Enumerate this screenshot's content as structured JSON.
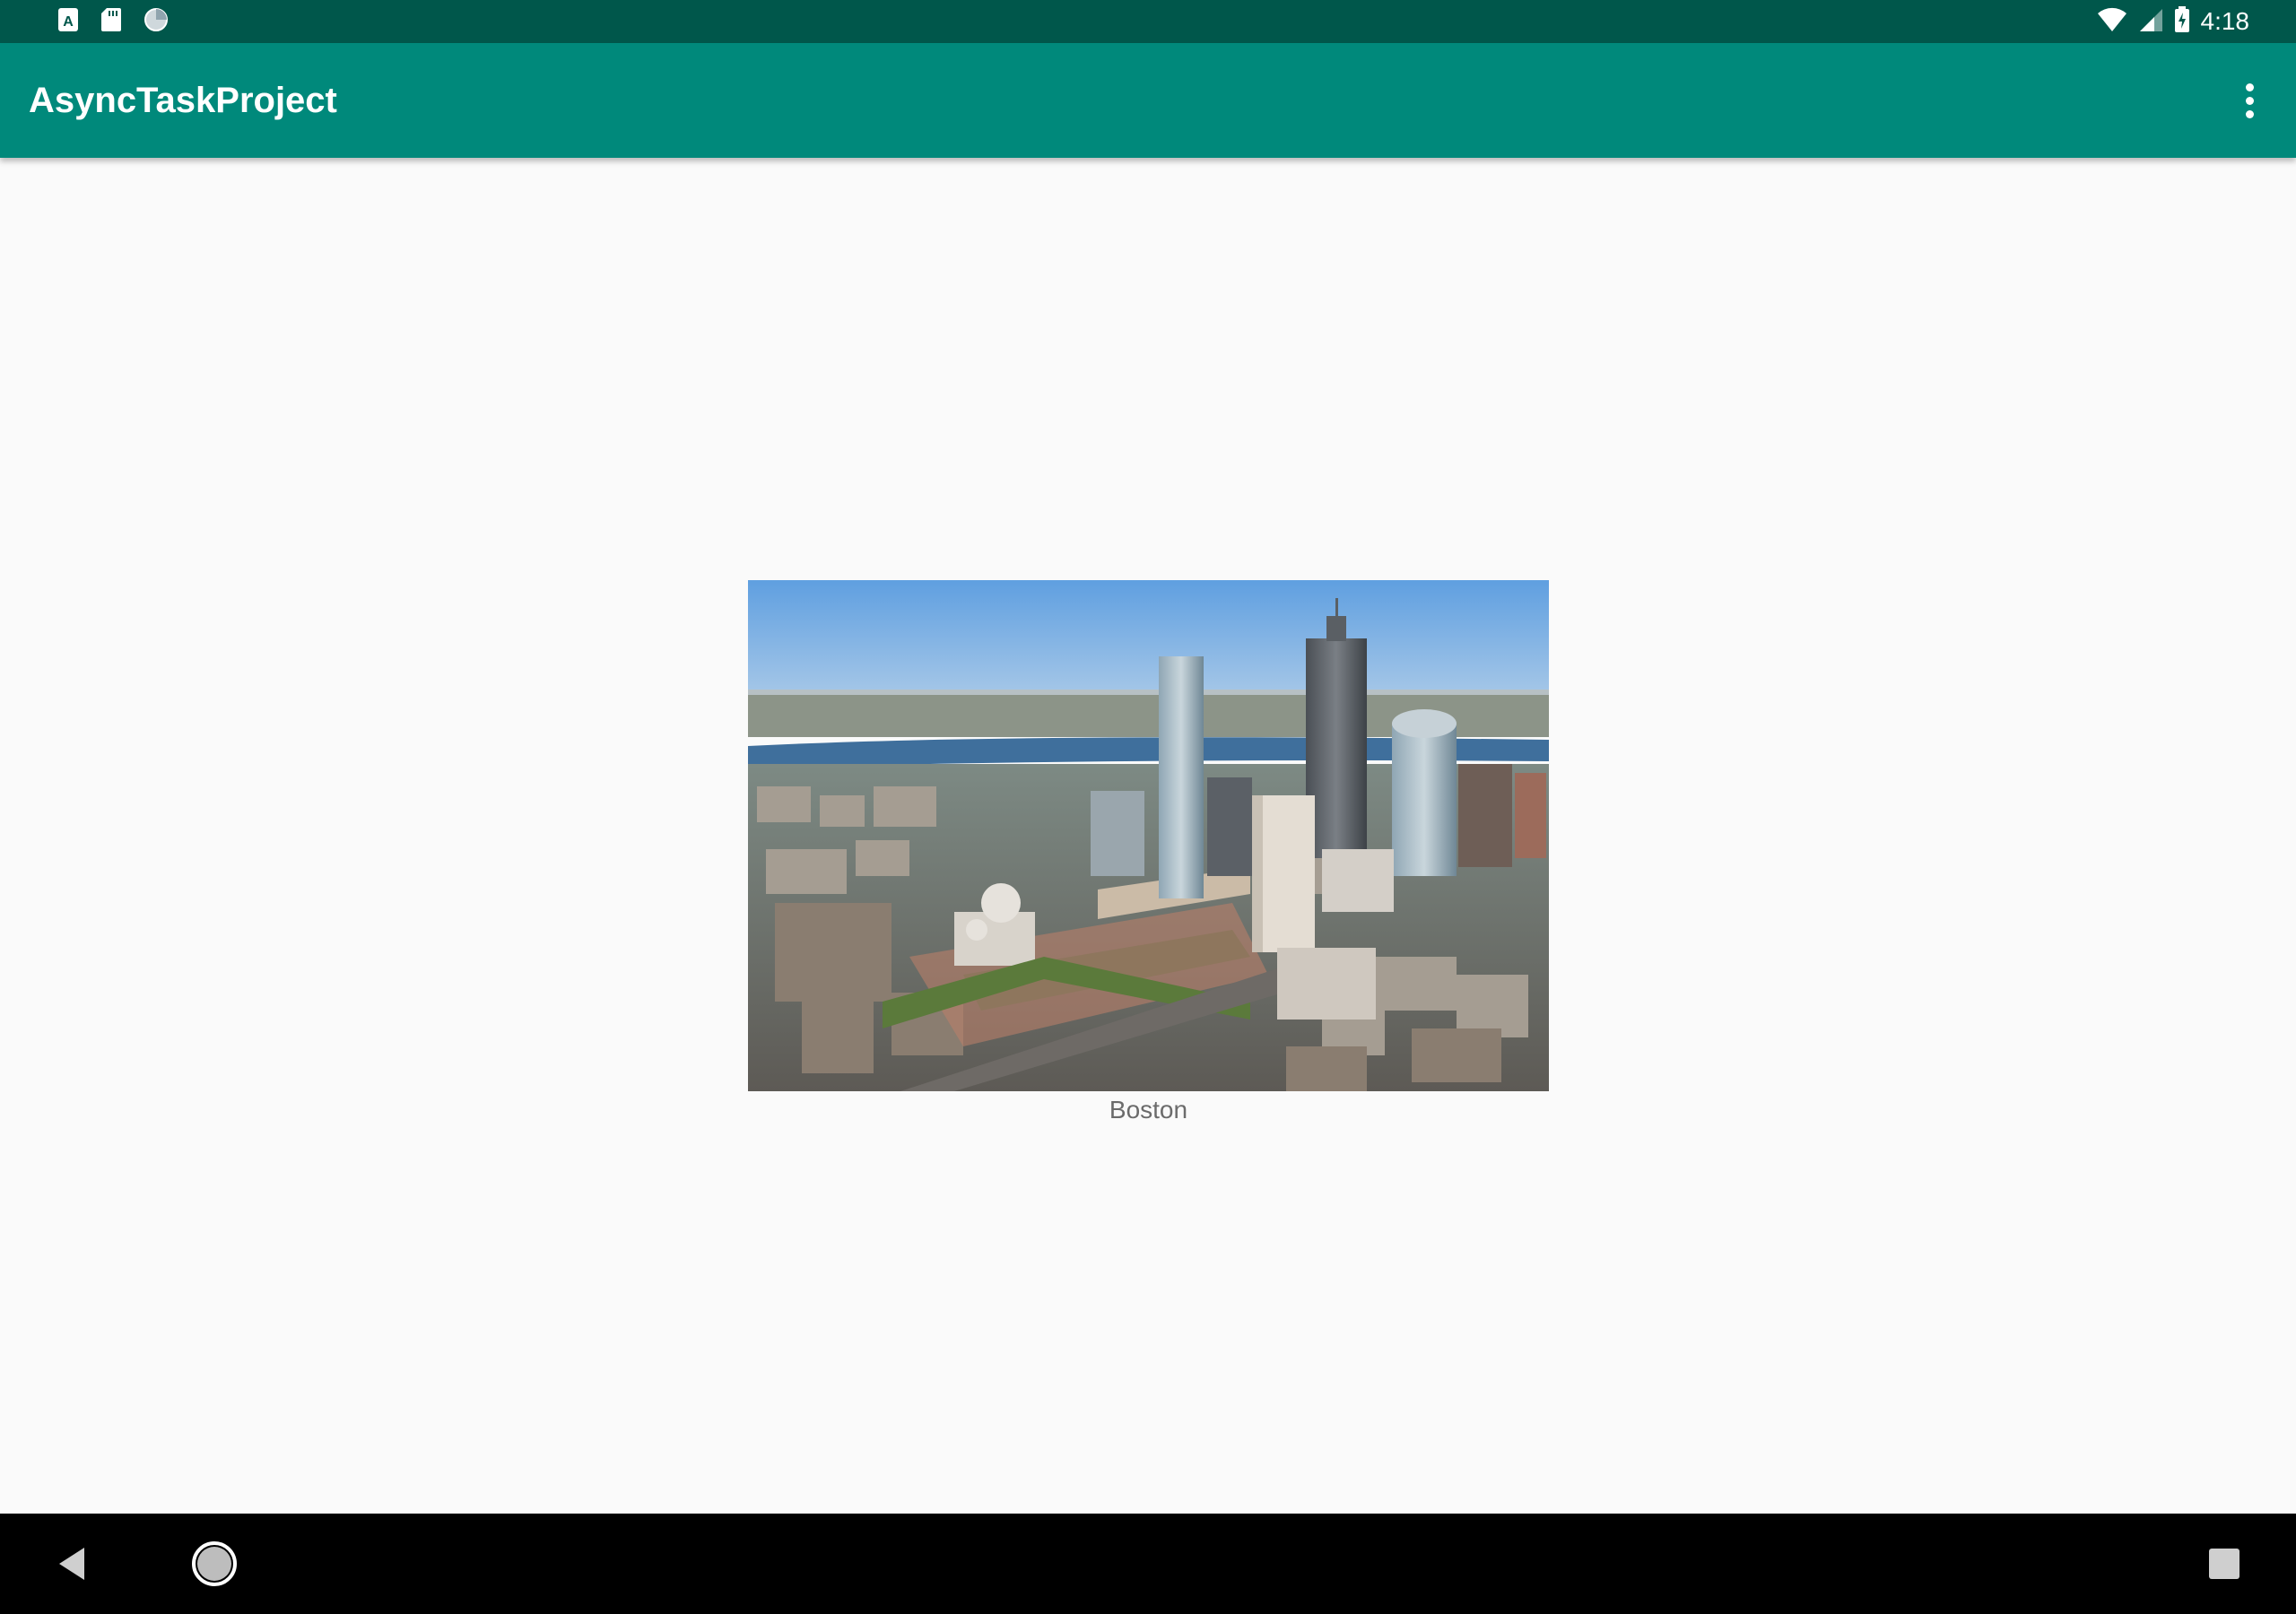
{
  "status_bar": {
    "time": "4:18",
    "left_icons": [
      "app-notification-icon",
      "sd-card-icon",
      "sync-circle-icon"
    ],
    "right_icons": [
      "wifi-icon",
      "cell-signal-icon",
      "battery-charging-icon"
    ]
  },
  "app_bar": {
    "title": "AsyncTaskProject",
    "overflow_icon": "more-vert-icon"
  },
  "main": {
    "image_caption": "Boston"
  },
  "nav_bar": {
    "buttons": [
      "back-icon",
      "home-icon",
      "recents-icon"
    ]
  },
  "colors": {
    "status_bar": "#00574b",
    "app_bar": "#00897b",
    "background": "#fafafa",
    "nav_bar": "#000000"
  }
}
